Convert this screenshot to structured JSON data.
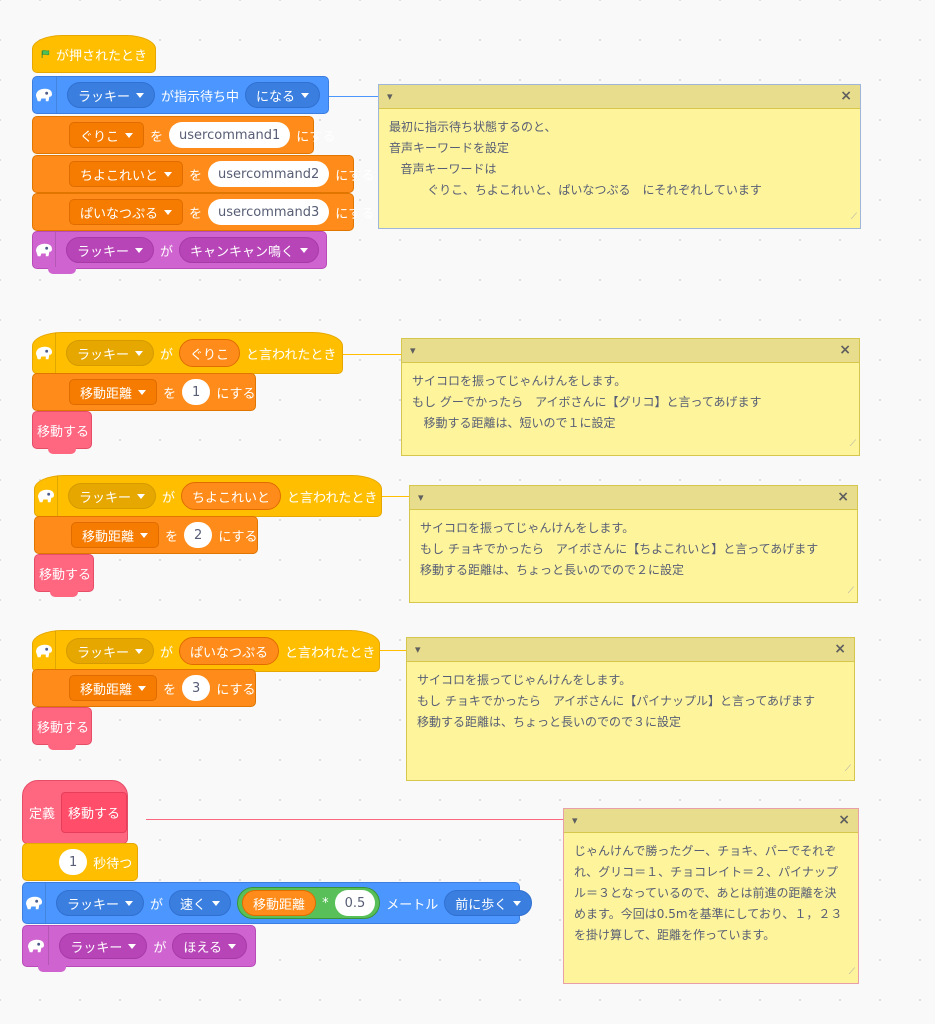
{
  "colors": {
    "events": "#ffbf00",
    "motion": "#ff8c1a",
    "extension": "#4c97ff",
    "looks": "#cf63cf",
    "custom": "#ff6680",
    "note": "#fef49c"
  },
  "icons": {
    "flag": "green-flag-icon",
    "robot": "robot-icon"
  },
  "script1": {
    "hat": "が押されたとき",
    "wait": {
      "robot": "ラッキー",
      "ga": "が指示待ち中",
      "mode": "になる"
    },
    "set1": {
      "var": "ぐりこ",
      "wo": "を",
      "value": "usercommand1",
      "suru": "にする"
    },
    "set2": {
      "var": "ちよこれいと",
      "wo": "を",
      "value": "usercommand2",
      "suru": "にする"
    },
    "set3": {
      "var": "ぱいなつぷる",
      "wo": "を",
      "value": "usercommand3",
      "suru": "にする"
    },
    "cry": {
      "robot": "ラッキー",
      "ga": "が",
      "sound": "キャンキャン鳴く"
    }
  },
  "script2": {
    "robot": "ラッキー",
    "ga": "が",
    "word": "ぐりこ",
    "said": "と言われたとき",
    "var": "移動距離",
    "wo": "を",
    "value": "1",
    "suru": "にする",
    "call": "移動する"
  },
  "script3": {
    "robot": "ラッキー",
    "ga": "が",
    "word": "ちよこれいと",
    "said": "と言われたとき",
    "var": "移動距離",
    "wo": "を",
    "value": "2",
    "suru": "にする",
    "call": "移動する"
  },
  "script4": {
    "robot": "ラッキー",
    "ga": "が",
    "word": "ぱいなつぷる",
    "said": "と言われたとき",
    "var": "移動距離",
    "wo": "を",
    "value": "3",
    "suru": "にする",
    "call": "移動する"
  },
  "script5": {
    "define": "定義",
    "name": "移動する",
    "wait": {
      "value": "1",
      "label": "秒待つ"
    },
    "move": {
      "robot": "ラッキー",
      "ga": "が",
      "speed": "速く",
      "var": "移動距離",
      "op": "*",
      "value": "0.5",
      "unit": "メートル",
      "dir": "前に歩く"
    },
    "bark": {
      "robot": "ラッキー",
      "ga": "が",
      "action": "ほえる"
    }
  },
  "notes": [
    {
      "text": "最初に指示待ち状態するのと、\n音声キーワードを設定\n   音声キーワードは\n          ぐりこ、ちよこれいと、ぱいなつぷる　にそれぞれしています"
    },
    {
      "text": "サイコロを振ってじゃんけんをします。\nもし グーでかったら　アイボさんに【グリコ】と言ってあげます\n   移動する距離は、短いので１に設定"
    },
    {
      "text": "サイコロを振ってじゃんけんをします。\nもし チョキでかったら　アイボさんに【ちよこれいと】と言ってあげます\n移動する距離は、ちょっと長いのでので２に設定"
    },
    {
      "text": "サイコロを振ってじゃんけんをします。\nもし チョキでかったら　アイボさんに【パイナップル】と言ってあげます\n移動する距離は、ちょっと長いのでので３に設定"
    },
    {
      "text": "じゃんけんで勝ったグー、チョキ、パーでそれぞれ、グリコ＝１、チョコレイト＝２、パイナップル＝３となっているので、あとは前進の距離を決めます。今回は0.5mを基準にしており、１，２３を掛け算して、距離を作っています。"
    }
  ],
  "note_close": "×"
}
